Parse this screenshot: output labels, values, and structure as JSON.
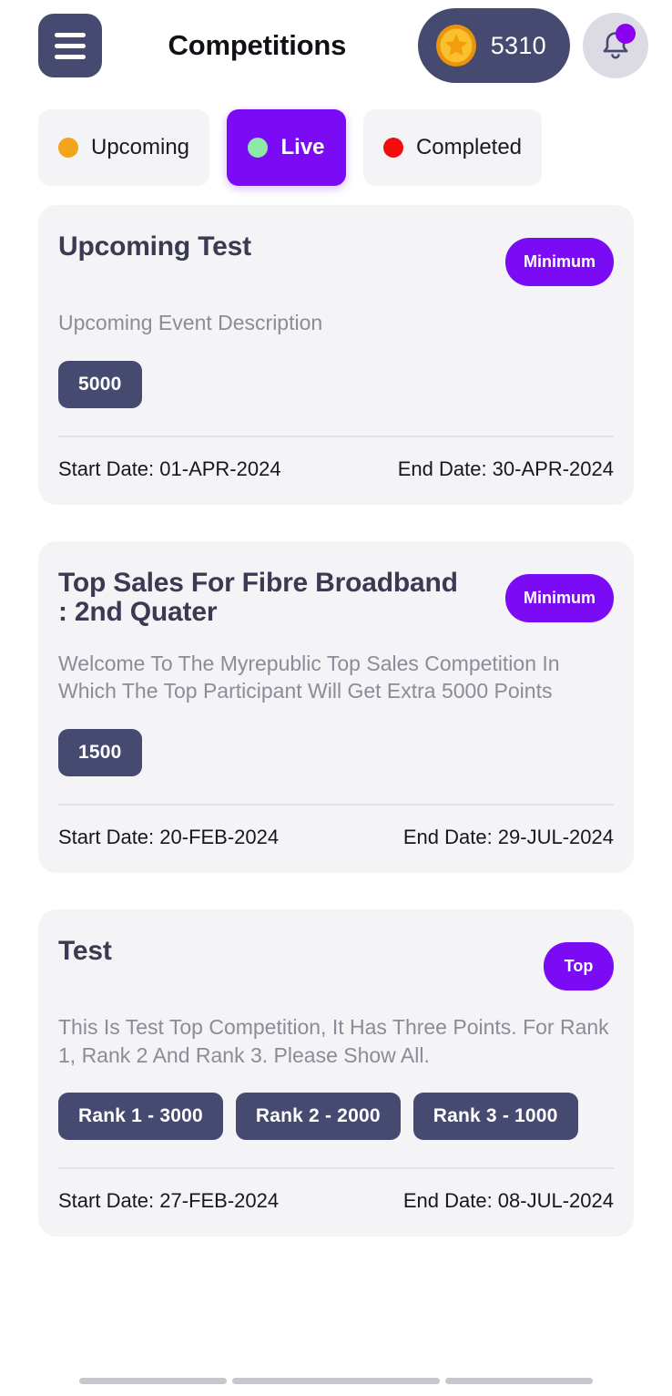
{
  "header": {
    "title": "Competitions",
    "menu_icon": "hamburger-menu-icon",
    "coin_icon": "gold-coin-star-icon",
    "coin_balance": "5310",
    "bell_icon": "notification-bell-icon",
    "bell_badge_color": "#8A00F0"
  },
  "tabs": [
    {
      "label": "Upcoming",
      "dot_color": "#F2A41A",
      "active": false
    },
    {
      "label": "Live",
      "dot_color": "#8EE8A8",
      "active": true
    },
    {
      "label": "Completed",
      "dot_color": "#F40C0C",
      "active": false
    }
  ],
  "colors": {
    "accent_purple": "#7B0AF5",
    "dark_slate": "#474A70",
    "card_bg": "#f4f3f6",
    "muted_text": "#8c8c99"
  },
  "competitions": [
    {
      "title": "Upcoming Test",
      "badge": "Minimum",
      "description": "Upcoming Event Description",
      "points": [
        "5000"
      ],
      "start_label": "Start Date: 01-APR-2024",
      "end_label": "End Date: 30-APR-2024"
    },
    {
      "title": "Top Sales For Fibre Broadband : 2nd Quater",
      "badge": "Minimum",
      "description": "Welcome To The Myrepublic Top Sales Competition In Which The Top Participant Will Get Extra 5000 Points",
      "points": [
        "1500"
      ],
      "start_label": "Start Date: 20-FEB-2024",
      "end_label": "End Date: 29-JUL-2024"
    },
    {
      "title": "Test",
      "badge": "Top",
      "description": "This Is Test Top Competition, It Has Three Points. For Rank 1, Rank 2 And Rank 3. Please Show All.",
      "points": [
        "Rank 1 - 3000",
        "Rank 2 - 2000",
        "Rank 3 - 1000"
      ],
      "start_label": "Start Date: 27-FEB-2024",
      "end_label": "End Date: 08-JUL-2024"
    }
  ]
}
